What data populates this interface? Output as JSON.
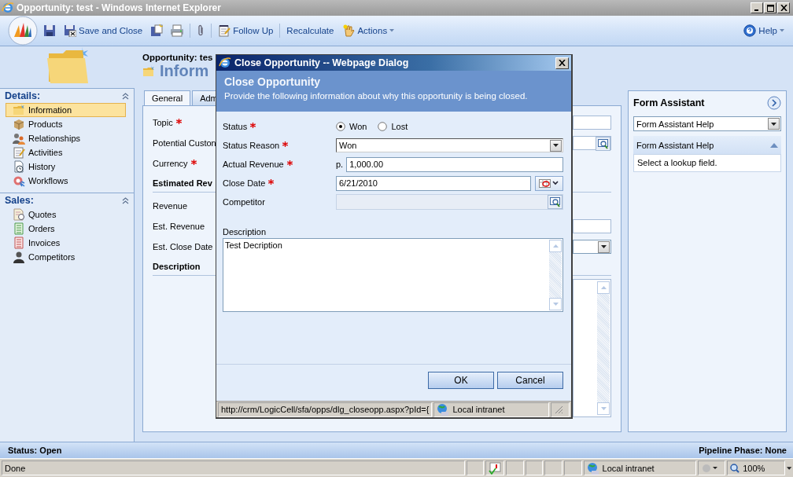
{
  "window": {
    "title": "Opportunity: test - Windows Internet Explorer"
  },
  "toolbar": {
    "buttons": [
      {
        "label": "Save and Close",
        "kind": "button"
      },
      {
        "label": "Follow Up",
        "kind": "button"
      },
      {
        "label": "Recalculate",
        "kind": "button"
      },
      {
        "label": "Actions",
        "kind": "menu"
      }
    ],
    "help": "Help"
  },
  "nav": {
    "sections": [
      {
        "title": "Details:",
        "expanded": true,
        "items": [
          {
            "label": "Information",
            "selected": true
          },
          {
            "label": "Products",
            "selected": false
          },
          {
            "label": "Relationships",
            "selected": false
          },
          {
            "label": "Activities",
            "selected": false
          },
          {
            "label": "History",
            "selected": false
          },
          {
            "label": "Workflows",
            "selected": false
          }
        ]
      },
      {
        "title": "Sales:",
        "expanded": true,
        "items": [
          {
            "label": "Quotes",
            "selected": false
          },
          {
            "label": "Orders",
            "selected": false
          },
          {
            "label": "Invoices",
            "selected": false
          },
          {
            "label": "Competitors",
            "selected": false
          }
        ]
      }
    ]
  },
  "record": {
    "entity": "Opportunity: tes",
    "heading": "Inform"
  },
  "form": {
    "tabs": [
      {
        "label": "General",
        "selected": true
      },
      {
        "label": "Adm",
        "selected": false
      }
    ],
    "rows": [
      {
        "kind": "text",
        "label": "Topic",
        "required": true
      },
      {
        "kind": "lookup",
        "label": "Potential Custon",
        "required": false
      },
      {
        "kind": "covered",
        "label": "Currency",
        "required": true
      },
      {
        "kind": "section",
        "label": "Estimated Rev"
      },
      {
        "kind": "covered",
        "label": "Revenue",
        "required": false
      },
      {
        "kind": "text",
        "label": "Est. Revenue",
        "required": false
      },
      {
        "kind": "select",
        "label": "Est. Close Date",
        "required": false
      },
      {
        "kind": "section",
        "label": "Description"
      },
      {
        "kind": "textarea"
      }
    ]
  },
  "assistant": {
    "title": "Form Assistant",
    "select": "Form Assistant Help",
    "section": "Form Assistant Help",
    "text": "Select a lookup field."
  },
  "dialog": {
    "title": "Close Opportunity -- Webpage Dialog",
    "header_title": "Close Opportunity",
    "header_text": "Provide the following information about why this opportunity is being closed.",
    "fields": [
      {
        "kind": "radio",
        "label": "Status",
        "required": true,
        "options": [
          {
            "label": "Won",
            "selected": true
          },
          {
            "label": "Lost",
            "selected": false
          }
        ]
      },
      {
        "kind": "select",
        "label": "Status Reason",
        "required": true,
        "value": "Won"
      },
      {
        "kind": "currency",
        "label": "Actual Revenue",
        "required": true,
        "symbol": "p.",
        "value": "1,000.00"
      },
      {
        "kind": "date",
        "label": "Close Date",
        "required": true,
        "value": "6/21/2010"
      },
      {
        "kind": "lookup",
        "label": "Competitor",
        "required": false,
        "disabled": true
      }
    ],
    "description": {
      "label": "Description",
      "value": "Test Decription"
    },
    "buttons": [
      "OK",
      "Cancel"
    ],
    "status": {
      "url": "http://crm/LogicCell/sfa/opps/dlg_closeopp.aspx?pId={",
      "zone": "Local intranet"
    }
  },
  "status_row": {
    "status": "Status: Open",
    "pipeline": "Pipeline Phase: None"
  },
  "browser_status": {
    "text": "Done",
    "zone": "Local intranet",
    "zoom": "100%"
  }
}
